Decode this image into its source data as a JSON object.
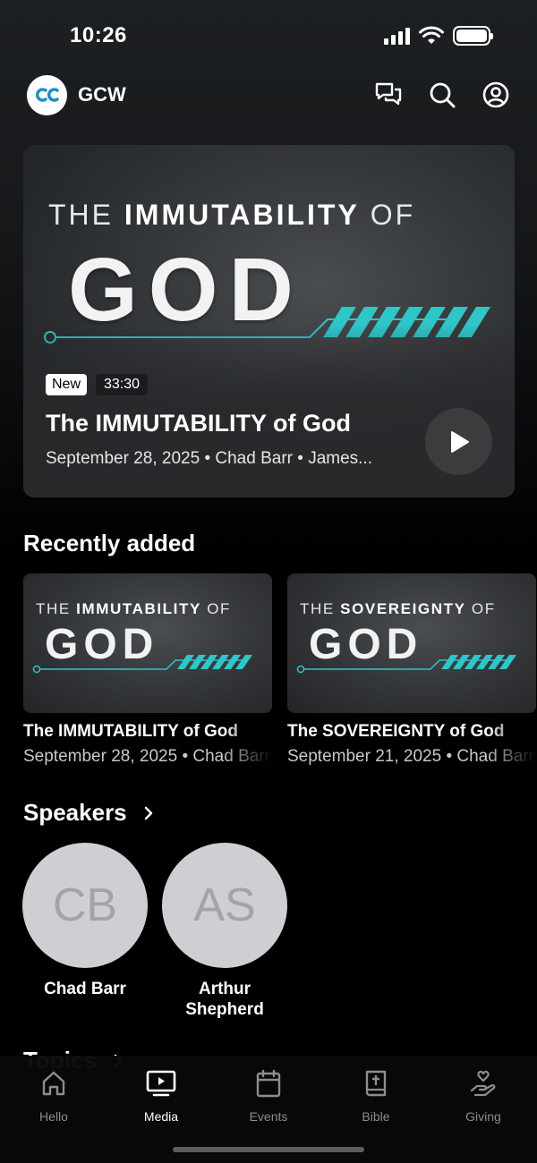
{
  "status_bar": {
    "time": "10:26"
  },
  "header": {
    "app_name": "GCW",
    "logo_text": "GC"
  },
  "hero": {
    "art_prefix": "THE",
    "art_highlight": "IMMUTABILITY",
    "art_suffix": "OF",
    "art_big": "GOD",
    "badge_new": "New",
    "duration": "33:30",
    "title": "The IMMUTABILITY of God",
    "meta": "September 28, 2025 • Chad Barr • James..."
  },
  "recently_added": {
    "title": "Recently added",
    "items": [
      {
        "art_prefix": "THE",
        "art_highlight": "IMMUTABILITY",
        "art_suffix": "OF",
        "art_big": "GOD",
        "title": "The IMMUTABILITY of God",
        "meta": "September 28, 2025 • Chad Barr"
      },
      {
        "art_prefix": "THE",
        "art_highlight": "SOVEREIGNTY",
        "art_suffix": "OF",
        "art_big": "GOD",
        "title": "The SOVEREIGNTY of God",
        "meta": "September 21, 2025 • Chad Barr"
      }
    ]
  },
  "speakers": {
    "title": "Speakers",
    "items": [
      {
        "initials": "CB",
        "name": "Chad Barr"
      },
      {
        "initials": "AS",
        "name": "Arthur Shepherd"
      }
    ]
  },
  "topics": {
    "title": "Topics"
  },
  "tab_bar": {
    "tabs": [
      {
        "label": "Hello",
        "icon": "home-icon"
      },
      {
        "label": "Media",
        "icon": "media-icon",
        "active": true
      },
      {
        "label": "Events",
        "icon": "calendar-icon"
      },
      {
        "label": "Bible",
        "icon": "bible-icon"
      },
      {
        "label": "Giving",
        "icon": "giving-icon"
      }
    ]
  },
  "colors": {
    "accent_teal": "#2fc6c9",
    "logo_blue": "#1f8fbf"
  }
}
